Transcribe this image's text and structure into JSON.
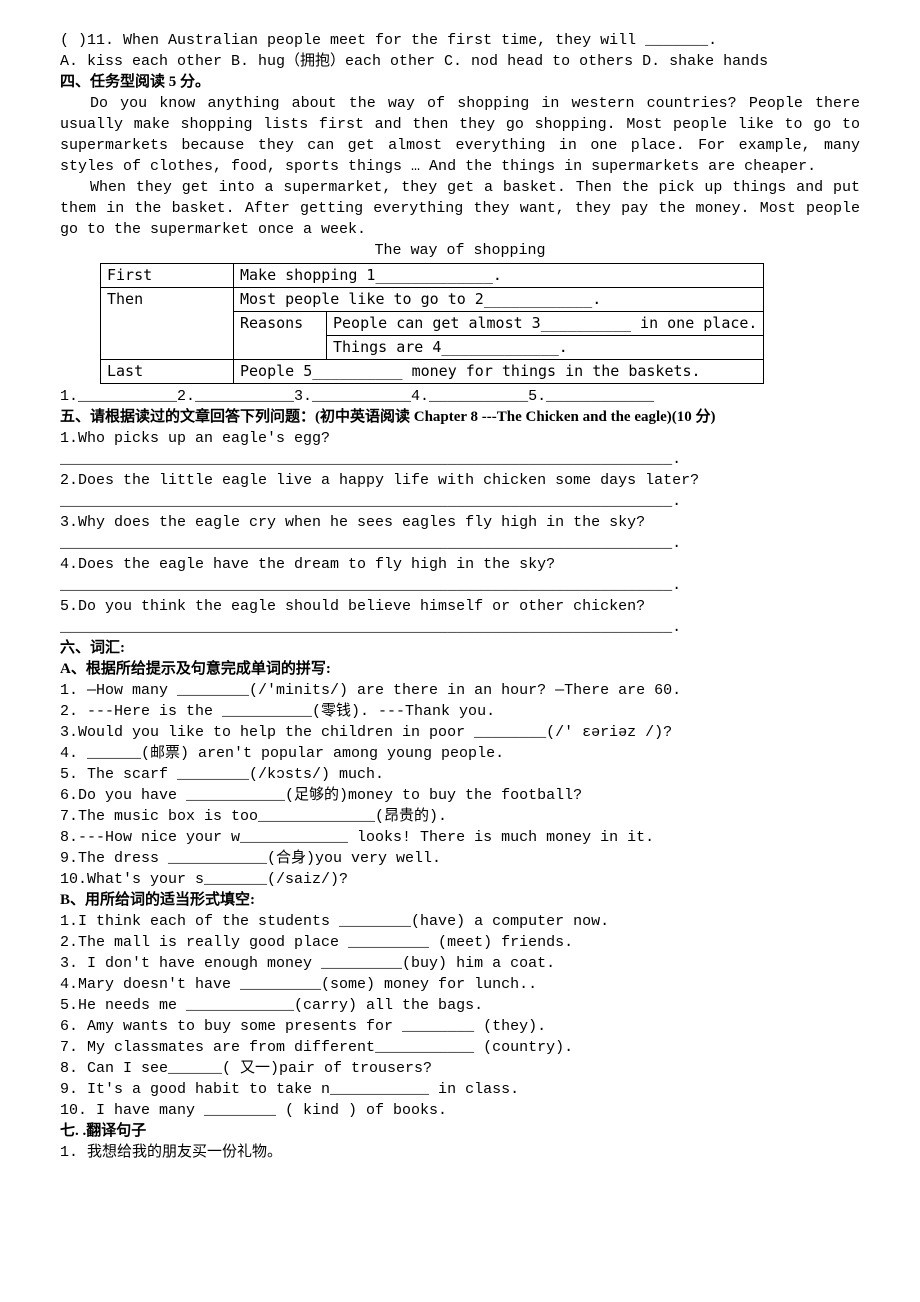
{
  "mc": {
    "q11": "(     )11. When Australian people meet for the first time, they will _______.",
    "q11opts": "       A. kiss each other B. hug（拥抱）each other C. nod head to others D. shake hands"
  },
  "s4": {
    "title": "四、任务型阅读 5 分。",
    "p1": "Do you know anything about the way of shopping in western countries? People there usually make shopping lists first and then they go shopping. Most people like to go to supermarkets because they can get almost everything in one place. For example, many styles of clothes, food, sports things … And the things in supermarkets are cheaper.",
    "p2": "When they get into a supermarket, they get a basket. Then the pick up things and put them in the basket. After getting everything they want, they pay the money. Most people go to the supermarket once a week.",
    "tabletitle": "The way of shopping",
    "r1c1": "First",
    "r1c2": "Make shopping 1_____________.",
    "r2c1": "Then",
    "r2c2": "Most people like to go to 2____________.",
    "r3c1": "Reasons",
    "r3c2": "People can get almost 3__________ in one place.",
    "r4c2": "Things are 4_____________.",
    "r5c1": "Last",
    "r5c2": "People 5__________ money for things in the baskets.",
    "ans": "1.___________2.___________3.___________4.___________5.____________"
  },
  "s5": {
    "title": "五、请根据读过的文章回答下列问题：(初中英语阅读 Chapter 8 ---The Chicken and the eagle)(10 分)",
    "q1": "1.Who picks up an eagle's  egg?",
    "q2": "2.Does the little eagle live a happy life with chicken some days later?",
    "q3": "3.Why does the eagle cry when he sees eagles fly high in the sky?",
    "q4": "4.Does the eagle have the dream to fly high in the sky?",
    "q5": "5.Do you think the eagle should believe himself or other chicken?",
    "blank": "____________________________________________________________________."
  },
  "s6": {
    "title": "六、词汇:",
    "atitle": "A、根据所给提示及句意完成单词的拼写:",
    "a1": "1. —How many ________(/'minits/) are there in an hour?  —There are 60.",
    "a2": "2. ---Here is the __________(零钱).  ---Thank you.",
    "a3": "3.Would you like to help the children in poor ________(/' ɛəriəz /)?",
    "a4": "4. ______(邮票) aren't popular among young people.",
    "a5": "5. The scarf   ________(/kɔsts/) much.",
    "a6": "6.Do you have ___________(足够的)money to buy the football?",
    "a7": "7.The music box is too_____________(昂贵的).",
    "a8": "8.---How nice your w____________ looks! There is much money in it.",
    "a9": "9.The dress ___________(合身)you very well.",
    "a10": "10.What's your s_______(/saiz/)?",
    "btitle": "B、用所给词的适当形式填空:",
    "b1": "1.I think each of the students ________(have) a computer now.",
    "b2": "2.The mall is really good place _________ (meet) friends.",
    "b3": "3. I don't have enough money _________(buy) him a coat.",
    "b4": "4.Mary doesn't have _________(some) money for lunch..",
    "b5": "5.He needs me ____________(carry) all the bags.",
    "b6": "6. Amy wants to buy some presents for ________ (they).",
    "b7": "7. My classmates are from different___________ (country).",
    "b8": "8. Can I see______(  又一)pair of trousers?",
    "b9": "9. It's a good habit to take  n___________ in class.",
    "b10": "10. I have many ________ ( kind ) of books."
  },
  "s7": {
    "title": "七. .翻译句子",
    "q1": "1. 我想给我的朋友买一份礼物。"
  }
}
